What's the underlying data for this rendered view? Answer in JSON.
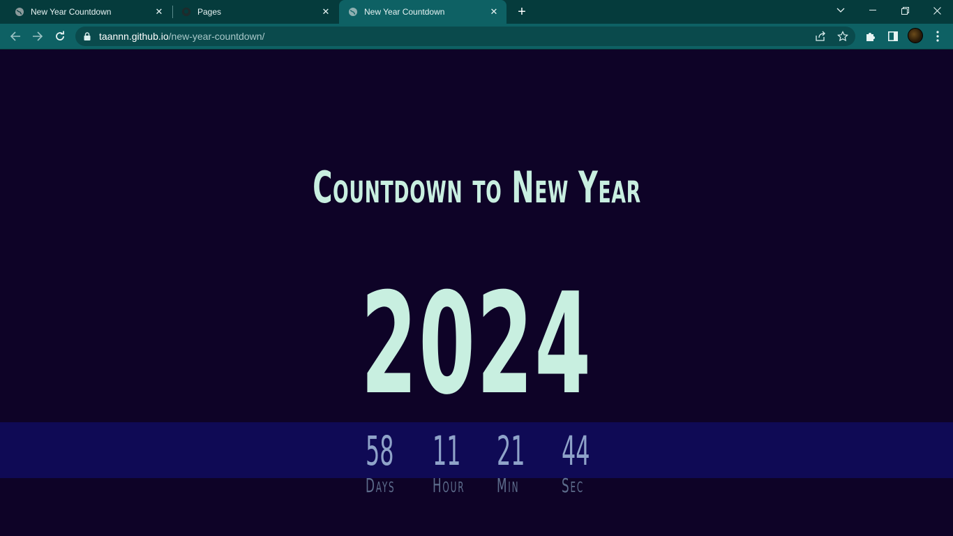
{
  "browser": {
    "tabs": [
      {
        "title": "New Year Countdown",
        "icon": "globe-icon",
        "active": false
      },
      {
        "title": "Pages",
        "icon": "github-icon",
        "active": false
      },
      {
        "title": "New Year Countdown",
        "icon": "globe-icon",
        "active": true
      }
    ],
    "url": {
      "host": "taannn.github.io",
      "path": "/new-year-countdown/"
    },
    "colors": {
      "tabstrip": "#053b3c",
      "toolbar": "#0e6164",
      "omnibox": "#0a4a4c"
    }
  },
  "page": {
    "heading": "Countdown to New Year",
    "year": "2024",
    "countdown": [
      {
        "value": "58",
        "label": "Days"
      },
      {
        "value": "11",
        "label": "Hour"
      },
      {
        "value": "21",
        "label": "Min"
      },
      {
        "value": "44",
        "label": "Sec"
      }
    ],
    "colors": {
      "background": "#0e0327",
      "band": "#0f0a55",
      "heading": "#c8efe0",
      "number": "#8fa3c9",
      "label": "#5d6d8c"
    }
  }
}
